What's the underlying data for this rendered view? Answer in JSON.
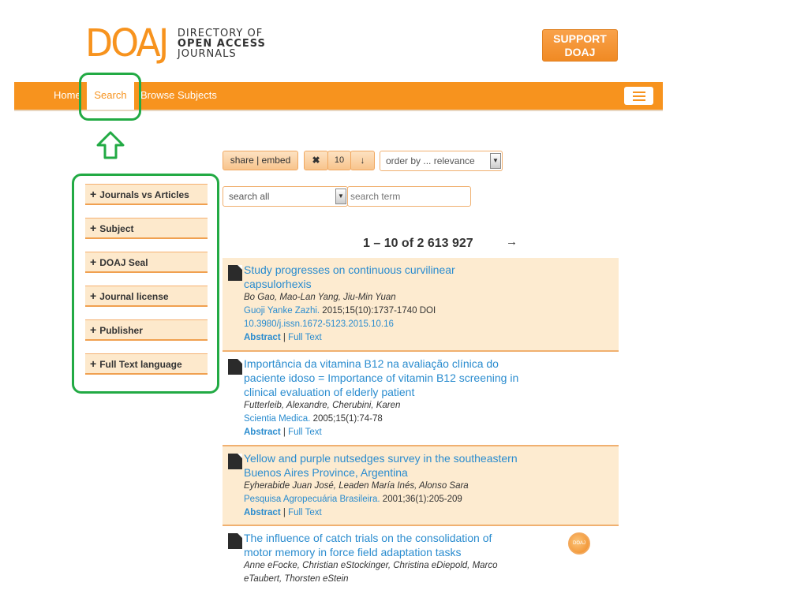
{
  "header": {
    "logo_mark": "DOAJ",
    "logo_lines": [
      "DIRECTORY OF",
      "OPEN ACCESS",
      "JOURNALS"
    ],
    "support_button": [
      "SUPPORT",
      "DOAJ"
    ]
  },
  "nav": {
    "items": [
      "Home",
      "Search",
      "Browse Subjects"
    ],
    "active": "Search",
    "menu_icon": "hamburger-icon"
  },
  "facets": [
    "Journals vs Articles",
    "Subject",
    "DOAJ Seal",
    "Journal license",
    "Publisher",
    "Full Text language"
  ],
  "toolbar": {
    "share_label": "share | embed",
    "clear_icon": "✖",
    "page_size": "10",
    "sort_icon": "↓",
    "order_select": "order by ... relevance"
  },
  "search": {
    "field_select": "search all",
    "placeholder": "search term"
  },
  "pagination": {
    "text": "1 – 10 of 2 613 927",
    "next_icon": "→"
  },
  "results": [
    {
      "title": "Study progresses on continuous curvilinear capsulorhexis",
      "authors": "Bo Gao, Mao-Lan Yang, Jiu-Min Yuan",
      "journal": "Guoji Yanke Zazhi.",
      "citation": " 2015;15(10):1737-1740 DOI",
      "doi": "10.3980/j.issn.1672-5123.2015.10.16",
      "abstract": "Abstract",
      "fulltext": "Full Text"
    },
    {
      "title": "Importância da vitamina B12 na avaliação clínica do paciente idoso = Importance of vitamin B12 screening in clinical evaluation of elderly patient",
      "authors": "Futterleib, Alexandre, Cherubini, Karen",
      "journal": "Scientia Medica.",
      "citation": " 2005;15(1):74-78",
      "abstract": "Abstract",
      "fulltext": "Full Text"
    },
    {
      "title": "Yellow and purple nutsedges survey in the southeastern Buenos Aires Province, Argentina",
      "authors": "Eyherabide Juan José, Leaden María Inés, Alonso Sara",
      "journal": "Pesquisa Agropecuária Brasileira.",
      "citation": " 2001;36(1):205-209",
      "abstract": "Abstract",
      "fulltext": "Full Text"
    },
    {
      "title": "The influence of catch trials on the consolidation of motor memory in force field adaptation tasks",
      "authors": "Anne eFocke, Christian eStockinger, Christina eDiepold, Marco eTaubert, Thorsten eStein",
      "seal": "DOAJ"
    }
  ],
  "colors": {
    "brand": "#f7931e",
    "link": "#2a8ccf",
    "annotation": "#22aa44",
    "shade": "#fdebd0"
  }
}
